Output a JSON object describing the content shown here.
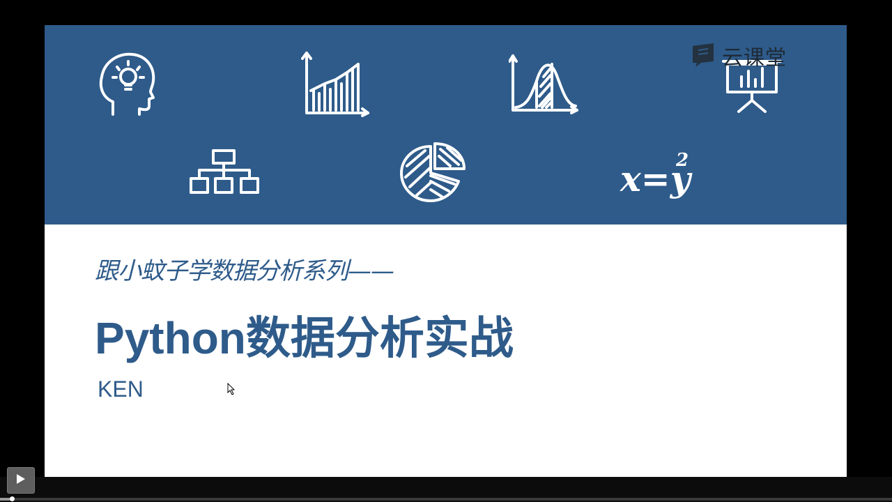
{
  "slide": {
    "logo_text": "云课堂",
    "subtitle": "跟小蚊子学数据分析系列——",
    "title": "Python数据分析实战",
    "author": "KEN"
  },
  "icons": [
    "brain-lightbulb-icon",
    "bar-chart-icon",
    "bell-curve-icon",
    "presentation-board-icon",
    "org-chart-icon",
    "pie-chart-icon",
    "equation-icon"
  ],
  "equation": {
    "base": "x=y",
    "exponent": "2"
  },
  "colors": {
    "banner": "#2e5b8a",
    "text_accent": "#2e5b8a",
    "player_bg": "#0c0c0c"
  },
  "player": {
    "progress": 0.012
  }
}
